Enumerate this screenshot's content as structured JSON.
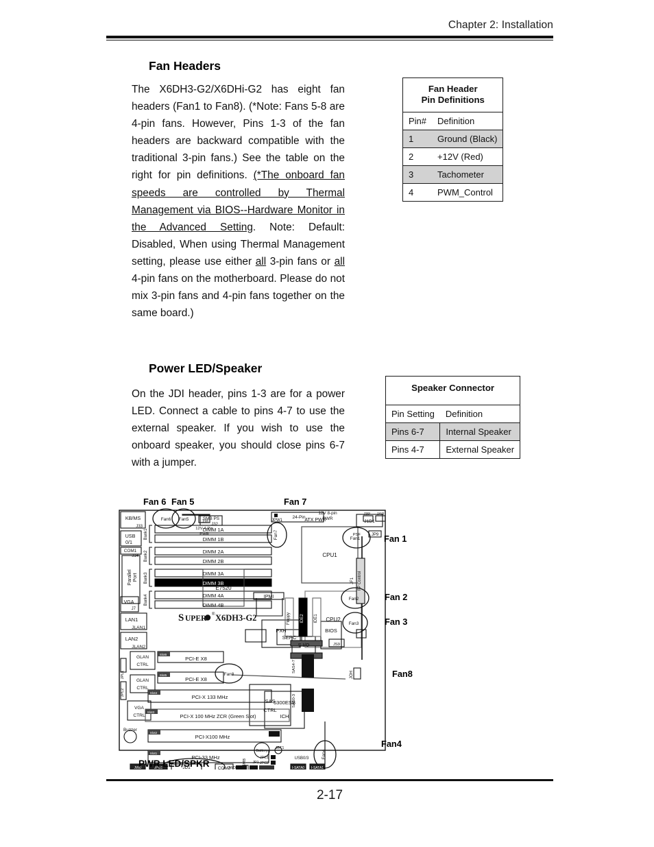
{
  "header": {
    "title": "Chapter 2: Installation"
  },
  "footer": {
    "page_number": "2-17"
  },
  "sections": {
    "fan_headers": {
      "heading": "Fan Headers",
      "para_1": "The X6DH3-G2/X6DHi-G2 has eight fan headers  (Fan1 to Fan8).  (*Note: Fans 5-8 are 4-pin fans. However,  Pins 1-3 of the fan headers are backward compatible with the traditional 3-pin fans.) See the table on the right for pin definitions. ",
      "underlined_1": "(*The onboard fan speeds are controlled by Thermal Management via BIOS--Hardware Monitor in the Advanced Setting",
      "para_2": ". Note: Default: Disabled, When using Thermal Management setting, please use either ",
      "underlined_all_1": "all",
      "para_3": " 3-pin fans or ",
      "underlined_all_2": "all",
      "para_4": " 4-pin fans on the motherboard. Please do not mix 3-pin fans and 4-pin fans together on the same board.)"
    },
    "power_led_speaker": {
      "heading": "Power LED/Speaker",
      "para_1": "On the JDI header, pins 1-3  are for a power LED. Connect a cable to pins 4-7 to use the external speaker. If you wish to use the onboard speaker, you should close pins 6-7 with a jumper."
    }
  },
  "fan_header_table": {
    "title_line_1": "Fan Header",
    "title_line_2": "Pin Definitions",
    "columns": [
      "Pin#",
      "Definition"
    ],
    "rows": [
      {
        "pin": "1",
        "definition": "Ground (Black)",
        "shaded": true
      },
      {
        "pin": "2",
        "definition": "+12V (Red)",
        "shaded": false
      },
      {
        "pin": "3",
        "definition": "Tachometer",
        "shaded": true
      },
      {
        "pin": "4",
        "definition": "PWM_Control",
        "shaded": false
      }
    ]
  },
  "speaker_table": {
    "title": "Speaker Connector",
    "columns": [
      "Pin Setting",
      "Definition"
    ],
    "rows": [
      {
        "setting": "Pins 6-7",
        "definition": "Internal Speaker",
        "shaded": true
      },
      {
        "setting": "Pins 4-7",
        "definition": "External Speaker",
        "shaded": false
      }
    ]
  },
  "diagram": {
    "board_name": "X6DH3-G2",
    "brand": "SUPER",
    "callouts": {
      "fan6": "Fan 6",
      "fan5": "Fan 5",
      "fan7": "Fan 7",
      "fan1": "Fan 1",
      "fan2": "Fan 2",
      "fan3": "Fan 3",
      "fan8": "Fan8",
      "fan4": "Fan4",
      "pwr_led_spkr": "PWR LED/SPKR"
    },
    "rear_io": [
      {
        "label": "KB/MS",
        "ref": "J33"
      },
      {
        "label": "USB",
        "sub": "0/1"
      },
      {
        "label": "COM1",
        "ref": "J14"
      },
      {
        "label": "Parallel Port"
      },
      {
        "label": "VGA",
        "ref": "J7"
      },
      {
        "label": "LAN1",
        "ref": "JLAN1"
      },
      {
        "label": "LAN2",
        "ref": "JLAN2"
      }
    ],
    "memory": {
      "banks": [
        "Bank1",
        "Bank2",
        "Bank3",
        "Bank4"
      ],
      "slots": [
        "DIMM 1A",
        "DIMM 1B",
        "DIMM 2A",
        "DIMM 2B",
        "DIMM 3A",
        "DIMM 3B",
        "DIMM 4A",
        "DIMM 4B"
      ]
    },
    "cpus": [
      "CPU1",
      "CPU2"
    ],
    "chips": [
      "E7520",
      "6300ESB",
      "ICH",
      "PXH",
      "BIOS",
      "S I/O",
      "SEPC",
      "GLAN CTRL",
      "GLAN CTRL",
      "VGA CTRL",
      "SAS CTRL",
      "IPMI"
    ],
    "expansion_slots": [
      {
        "slot": "Slot6",
        "label": "PCI-E X8"
      },
      {
        "slot": "Slot5",
        "label": "PCI-E X8"
      },
      {
        "slot": "Slot4",
        "label": "PCI-X 133 MHz"
      },
      {
        "slot": "Slot3",
        "label": "PCI-X 100 MHz ZCR (Green Slot)"
      },
      {
        "slot": "Slot2",
        "label": "PCI-X100 MHz"
      },
      {
        "slot": "Slot1",
        "label": "PCI-33 MHz"
      }
    ],
    "power_connectors": [
      {
        "label": "24-Pin ATX PWR",
        "ref": "JPW1"
      },
      {
        "label": "12V 4-Pin PWR",
        "ref": "J38"
      },
      {
        "label": "12V 8-pin PWR",
        "ref": "J1D1"
      }
    ],
    "misc_labels": [
      "SMB PS",
      "J32",
      "J3P",
      "JAR",
      "PSF",
      "JP9",
      "JF1",
      "FP Control",
      "JOH",
      "JPL1",
      "JPL2",
      "Buzzer",
      "Battery",
      "JBT1",
      "JPC1",
      "JPC2",
      "JD1",
      "COM2",
      "SMB",
      "USB0/3",
      "JWD",
      "I-SATA0",
      "I-SATA1",
      "JWOR",
      "JP1",
      "JS10",
      "JB1",
      "JSM1",
      "JSM2",
      "SAS4-7",
      "SAS0-3",
      "Floppy",
      "IDE2",
      "IDE1",
      "JS9"
    ]
  }
}
